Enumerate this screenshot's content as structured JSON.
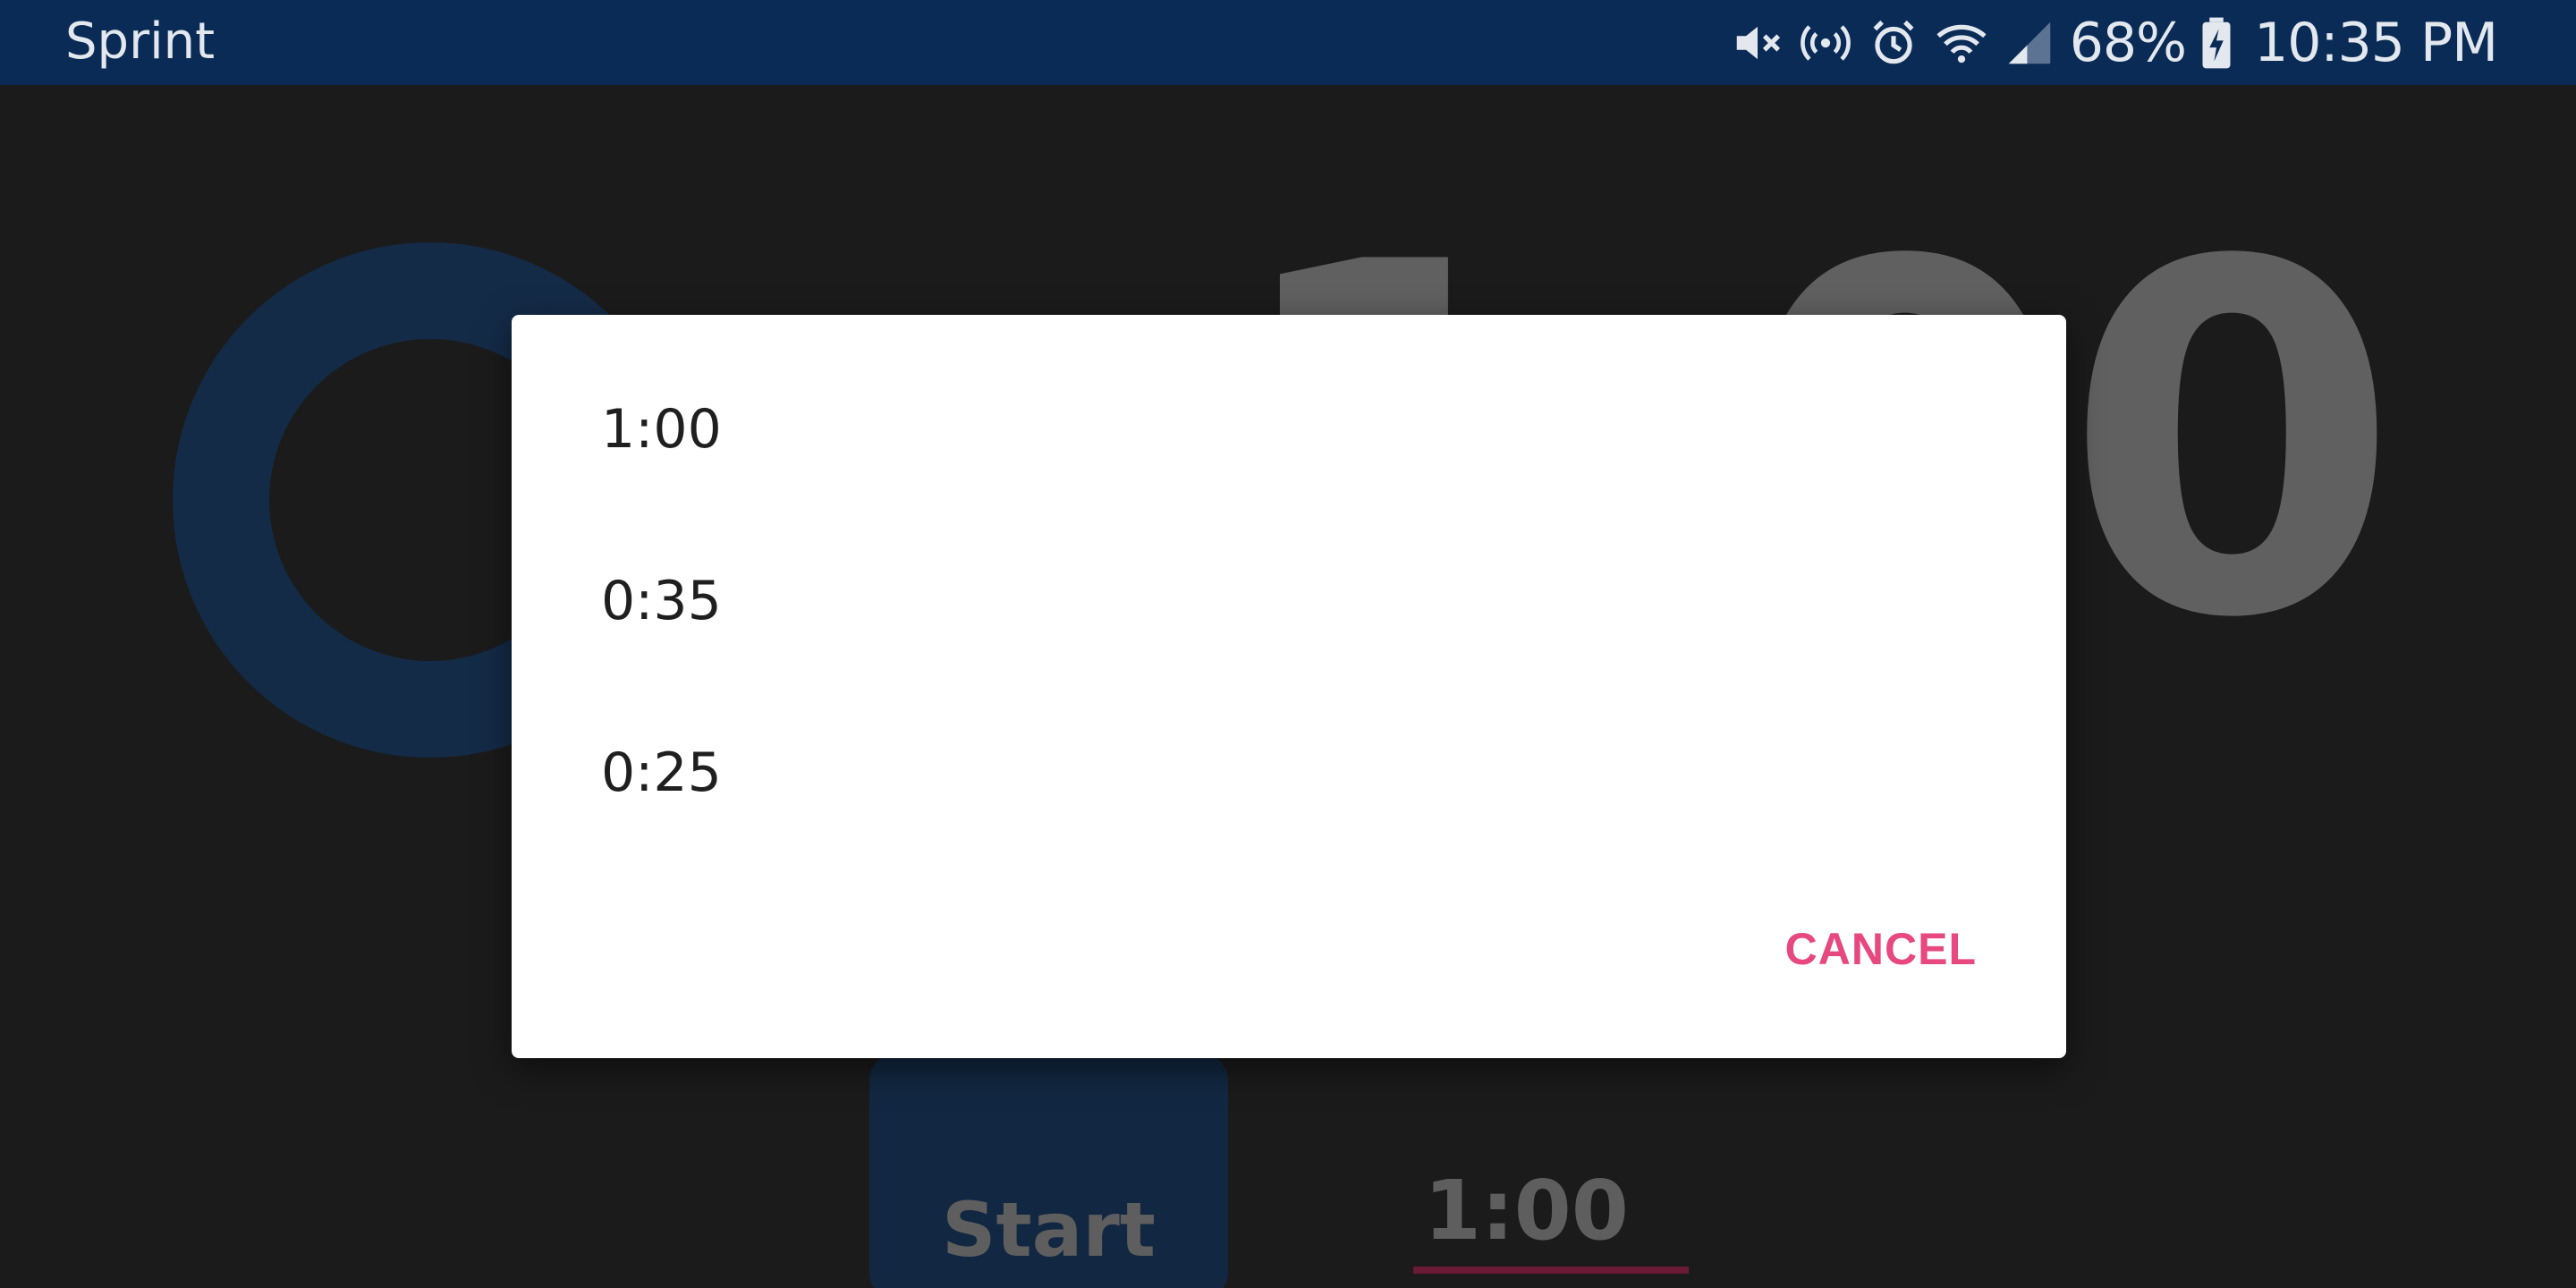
{
  "status_bar": {
    "carrier": "Sprint",
    "battery_percent": "68%",
    "time": "10:35 PM",
    "icons": [
      "mute-vibrate-icon",
      "hotspot-icon",
      "alarm-icon",
      "wifi-icon",
      "signal-icon",
      "battery-charging-icon"
    ]
  },
  "app": {
    "big_timer": "1:00",
    "start_label": "Start",
    "duration_value": "1:00",
    "colors": {
      "ring": "#142b47",
      "start_button": "#122842",
      "underline": "#6a1a34"
    }
  },
  "dialog": {
    "options": [
      {
        "label": "1:00"
      },
      {
        "label": "0:35"
      },
      {
        "label": "0:25"
      }
    ],
    "cancel_label": "CANCEL",
    "accent_color": "#e6487f"
  }
}
